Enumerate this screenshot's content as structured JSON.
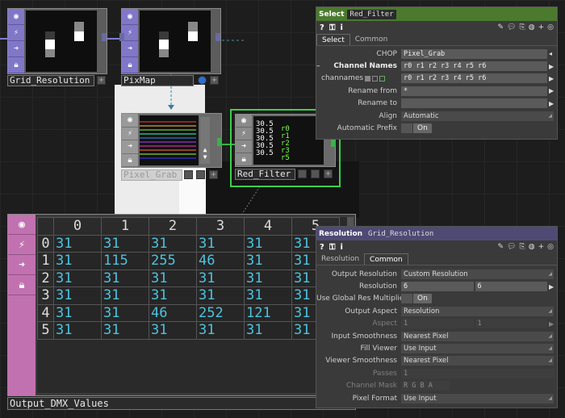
{
  "colors": {
    "select_header": "#4b7a2e",
    "resolution_header": "#4f4a74",
    "cell_text": "#4ec3e0",
    "table_strip": "#c271b0",
    "top_strip": "#8077c9"
  },
  "nodes": {
    "grid_resolution": {
      "label": "Grid_Resolution"
    },
    "pixmap": {
      "label": "PixMap"
    },
    "pixel_grab": {
      "label": "Pixel_Grab"
    },
    "red_filter": {
      "label": "Red_Filter"
    },
    "output_dmx": {
      "label": "Output_DMX_Values"
    }
  },
  "red_filter_viewer": {
    "values": [
      "30.5",
      "30.5",
      "30.5",
      "30.5",
      "30.5"
    ],
    "channels": [
      "r0",
      "r1",
      "r2",
      "r3",
      "r5"
    ]
  },
  "select_panel": {
    "title": "Select",
    "name": "Red_Filter",
    "tabs": [
      "Select",
      "Common"
    ],
    "active_tab": "Select",
    "params": {
      "chop": {
        "label": "CHOP",
        "value": "Pixel_Grab"
      },
      "channel_names": {
        "label": "Channel Names",
        "value": "r0 r1 r2 r3 r4 r5 r6"
      },
      "channames": {
        "label": "channames",
        "value": "r0 r1 r2 r3 r4 r5 r6"
      },
      "rename_from": {
        "label": "Rename from",
        "value": "*"
      },
      "rename_to": {
        "label": "Rename to",
        "value": ""
      },
      "align": {
        "label": "Align",
        "value": "Automatic"
      },
      "automatic_prefix": {
        "label": "Automatic Prefix",
        "value": "On"
      }
    }
  },
  "resolution_panel": {
    "title": "Resolution",
    "name": "Grid_Resolution",
    "tabs": [
      "Resolution",
      "Common"
    ],
    "active_tab": "Common",
    "params": {
      "output_resolution": {
        "label": "Output Resolution",
        "value": "Custom Resolution"
      },
      "resolution": {
        "label": "Resolution",
        "w": "6",
        "h": "6"
      },
      "global_res": {
        "label": "Use Global Res Multiplier",
        "value": "On"
      },
      "output_aspect": {
        "label": "Output Aspect",
        "value": "Resolution"
      },
      "aspect": {
        "label": "Aspect",
        "a": "1",
        "b": "1"
      },
      "input_smoothness": {
        "label": "Input Smoothness",
        "value": "Nearest Pixel"
      },
      "fill_viewer": {
        "label": "Fill Viewer",
        "value": "Use Input"
      },
      "viewer_smoothness": {
        "label": "Viewer Smoothness",
        "value": "Nearest Pixel"
      },
      "passes": {
        "label": "Passes",
        "value": "1"
      },
      "channel_mask": {
        "label": "Channel Mask",
        "value": "R G B A"
      },
      "pixel_format": {
        "label": "Pixel Format",
        "value": "Use Input"
      }
    }
  },
  "dmx_table": {
    "columns": [
      "0",
      "1",
      "2",
      "3",
      "4",
      "5"
    ],
    "rows": [
      {
        "index": "0",
        "cells": [
          "31",
          "31",
          "31",
          "31",
          "31",
          "31"
        ]
      },
      {
        "index": "1",
        "cells": [
          "31",
          "115",
          "255",
          "46",
          "31",
          "31"
        ]
      },
      {
        "index": "2",
        "cells": [
          "31",
          "31",
          "31",
          "31",
          "31",
          "31"
        ]
      },
      {
        "index": "3",
        "cells": [
          "31",
          "31",
          "31",
          "31",
          "31",
          "31"
        ]
      },
      {
        "index": "4",
        "cells": [
          "31",
          "31",
          "46",
          "252",
          "121",
          "31"
        ]
      },
      {
        "index": "5",
        "cells": [
          "31",
          "31",
          "31",
          "31",
          "31",
          "31"
        ]
      }
    ]
  }
}
